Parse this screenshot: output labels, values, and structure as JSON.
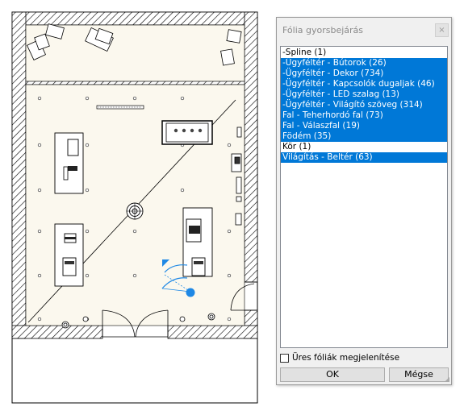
{
  "dialog": {
    "title": "Fólia gyorsbejárás",
    "close_label": "×",
    "layers": [
      {
        "label": "-Spline (1)",
        "selected": false
      },
      {
        "label": "-Ügyféltér - Bútorok (26)",
        "selected": true
      },
      {
        "label": "-Ügyféltér - Dekor (734)",
        "selected": true
      },
      {
        "label": "-Ügyféltér - Kapcsolók dugaljak (46)",
        "selected": true
      },
      {
        "label": "-Ügyféltér - LED szalag (13)",
        "selected": true
      },
      {
        "label": "-Ügyféltér - Világító szöveg (314)",
        "selected": true
      },
      {
        "label": "Fal - Teherhordó fal (73)",
        "selected": true
      },
      {
        "label": "Fal - Válaszfal (19)",
        "selected": true
      },
      {
        "label": "Födém (35)",
        "selected": true
      },
      {
        "label": "Kör (1)",
        "selected": false
      },
      {
        "label": "Világítás - Beltér (63)",
        "selected": true
      }
    ],
    "show_empty_label": "Üres fóliák megjelenítése",
    "show_empty_checked": false,
    "ok_label": "OK",
    "cancel_label": "Mégse"
  },
  "colors": {
    "selection": "#0078d7",
    "floor_fill": "#fbf8ee",
    "selection_handle": "#1e88e5"
  }
}
